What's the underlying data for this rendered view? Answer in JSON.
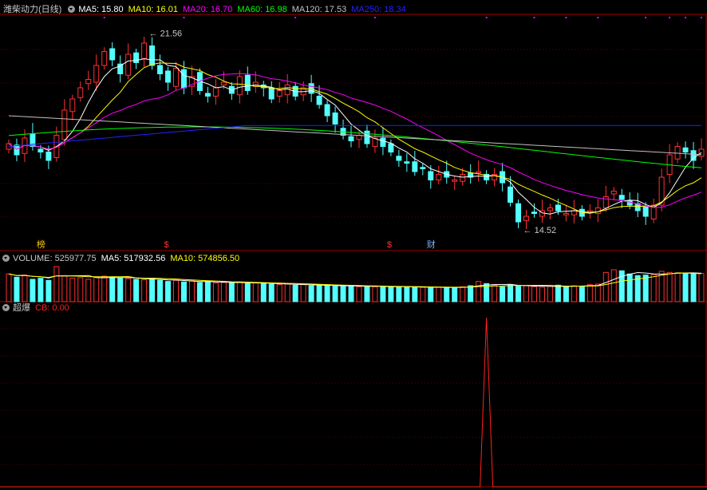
{
  "colors": {
    "up": "#ff3030",
    "down": "#54ffff",
    "frame": "#a00000",
    "grid": "#600000",
    "ma5": "#ffffff",
    "ma10": "#ffff00",
    "ma20": "#ff00ff",
    "ma60": "#00ff00",
    "ma120": "#c0c0c0",
    "ma250": "#2222ff",
    "cb": "#ff2020"
  },
  "header": {
    "stock": "潍柴动力(日线)",
    "ma5": "MA5: 15.80",
    "ma10": "MA10: 16.01",
    "ma20": "MA20: 16.70",
    "ma60": "MA60: 16.98",
    "ma120": "MA120: 17.53",
    "ma250": "MA250: 18.34",
    "menu_icon": "chevron-down-icon"
  },
  "volume_header": {
    "volume": "VOLUME: 525977.75",
    "ma5": "MA5: 517932.56",
    "ma10": "MA10: 574856.50"
  },
  "indicator_header": {
    "name": "超爆",
    "cb": "CB: 0.00"
  },
  "annotations": {
    "high": "21.56",
    "low": "14.52",
    "markers": [
      "榜",
      "$",
      "$",
      "财"
    ]
  },
  "chart_data": [
    {
      "type": "candlestick",
      "title": "潍柴动力(日线)",
      "ylim": [
        14.0,
        22.0
      ],
      "days": 88,
      "high_label": 21.56,
      "low_label": 14.52,
      "close": [
        17.6,
        17.2,
        17.8,
        17.5,
        17.3,
        17.0,
        17.9,
        18.8,
        19.2,
        19.6,
        19.9,
        20.4,
        20.9,
        20.6,
        20.1,
        20.8,
        20.5,
        21.2,
        20.4,
        20.1,
        19.8,
        20.3,
        19.6,
        20.0,
        19.5,
        19.3,
        19.6,
        19.8,
        19.4,
        20.0,
        19.5,
        19.8,
        19.6,
        19.2,
        19.5,
        19.7,
        19.3,
        19.6,
        19.4,
        19.0,
        18.6,
        18.3,
        17.9,
        17.7,
        17.9,
        17.6,
        17.8,
        17.5,
        17.3,
        17.0,
        16.9,
        16.6,
        16.7,
        16.3,
        16.5,
        16.4,
        16.3,
        16.5,
        16.4,
        16.6,
        16.3,
        16.5,
        16.2,
        15.5,
        14.8,
        15.0,
        15.1,
        15.2,
        15.3,
        15.2,
        15.1,
        15.2,
        15.0,
        15.2,
        15.3,
        15.7,
        15.9,
        15.6,
        15.4,
        15.2,
        15.0,
        15.4,
        16.4,
        17.2,
        17.5,
        17.3,
        17.0,
        17.4
      ],
      "overlays": [
        "MA5",
        "MA10",
        "MA20",
        "MA60",
        "MA120",
        "MA250"
      ],
      "grid": true
    },
    {
      "type": "bar",
      "title": "VOLUME",
      "values": [
        52,
        46,
        50,
        42,
        44,
        40,
        66,
        49,
        44,
        45,
        42,
        46,
        48,
        46,
        44,
        43,
        42,
        41,
        44,
        40,
        38,
        40,
        37,
        39,
        36,
        38,
        35,
        36,
        35,
        37,
        34,
        35,
        34,
        33,
        32,
        33,
        31,
        32,
        30,
        31,
        30,
        29,
        29,
        30,
        28,
        29,
        28,
        29,
        27,
        28,
        28,
        27,
        27,
        26,
        27,
        27,
        26,
        28,
        30,
        38,
        34,
        31,
        28,
        32,
        29,
        30,
        28,
        27,
        29,
        31,
        28,
        30,
        29,
        32,
        33,
        55,
        60,
        58,
        52,
        49,
        50,
        51,
        57,
        55,
        54,
        53,
        52,
        53
      ],
      "overlays": [
        "MA5",
        "MA10"
      ]
    },
    {
      "type": "line",
      "title": "超爆",
      "series": [
        {
          "name": "CB",
          "spike_index": 60,
          "spike_value": 1.0
        }
      ],
      "ylim": [
        0,
        1
      ]
    }
  ]
}
